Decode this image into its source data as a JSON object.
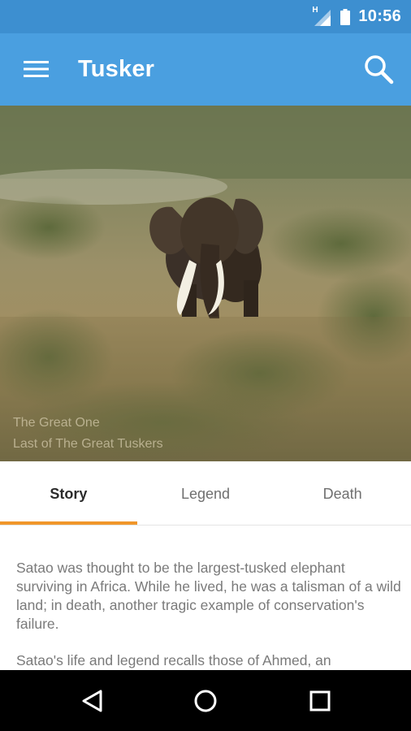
{
  "status_bar": {
    "time": "10:56",
    "network_indicator": "H",
    "icons": [
      "signal-icon",
      "battery-icon"
    ]
  },
  "app_bar": {
    "title": "Tusker",
    "icons": [
      "menu-icon",
      "search-icon"
    ]
  },
  "hero": {
    "image": "elephant-photo",
    "caption_line1": "The Great One",
    "caption_line2": "Last of The Great Tuskers"
  },
  "tabs": [
    {
      "label": "Story",
      "active": true
    },
    {
      "label": "Legend",
      "active": false
    },
    {
      "label": "Death",
      "active": false
    }
  ],
  "content": {
    "paragraph1": "Satao was thought to be the largest-tusked elephant surviving in Africa. While he lived, he was a talisman of a wild land; in death, another tragic example of conservation's failure.",
    "paragraph2": "Satao's life and legend recalls those of Ahmed, an"
  },
  "nav_bar": {
    "icons": [
      "back-icon",
      "home-icon",
      "recents-icon"
    ]
  },
  "colors": {
    "status_bar": "#3d8fd0",
    "app_bar": "#4a9fe0",
    "tab_indicator": "#f0962a",
    "nav_bar": "#000000"
  }
}
